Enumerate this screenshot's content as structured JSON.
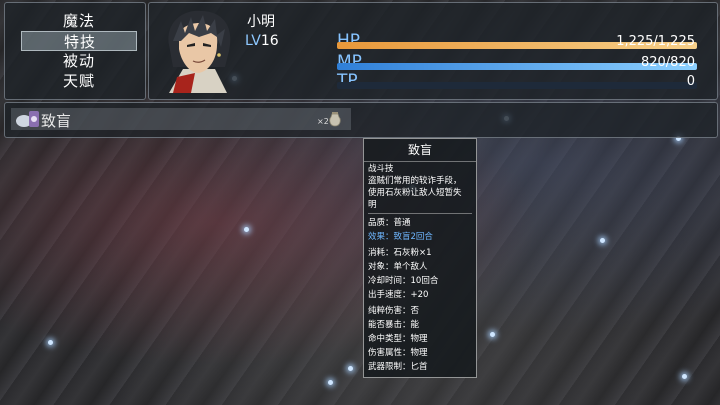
{
  "menu": {
    "items": [
      {
        "label": "魔法",
        "selected": false
      },
      {
        "label": "特技",
        "selected": true
      },
      {
        "label": "被动",
        "selected": false
      },
      {
        "label": "天赋",
        "selected": false
      }
    ]
  },
  "actor": {
    "name": "小明",
    "level_label": "LV",
    "level": "16",
    "hp_label": "HP",
    "hp_value": "1,225/1,225",
    "hp_fraction": 1.0,
    "mp_label": "MP",
    "mp_value": "820/820",
    "mp_fraction": 1.0,
    "tp_label": "TP",
    "tp_value": "0",
    "tp_fraction": 0.0
  },
  "skill_list": {
    "selected_skill": "致盲",
    "cost_label": "×2",
    "cost_icon": "powder-bag-icon",
    "skill_icon": "blind-skill-icon"
  },
  "tooltip": {
    "title": "致盲",
    "type": "战斗技",
    "description": [
      "盗贼们常用的较诈手段，",
      "使用石灰粉让敌人短暂失",
      "明"
    ],
    "quality": "品质：普通",
    "effect": "效果：致盲2回合",
    "stats": [
      "消耗：石灰粉×1",
      "对象：单个敌人",
      "冷却时间：10回合",
      "出手速度：+20",
      "纯粹伤害：否",
      "能否暴击：能",
      "命中类型：物理",
      "伤害属性：物理",
      "武器限制：匕首"
    ]
  },
  "colors": {
    "hp_gradient": [
      "#e8983a",
      "#f7d08a"
    ],
    "mp_gradient": [
      "#2f7fd8",
      "#8cd0ff"
    ],
    "tp_track": "#1e2a3a",
    "accent_blue": "#6fb7ff"
  }
}
